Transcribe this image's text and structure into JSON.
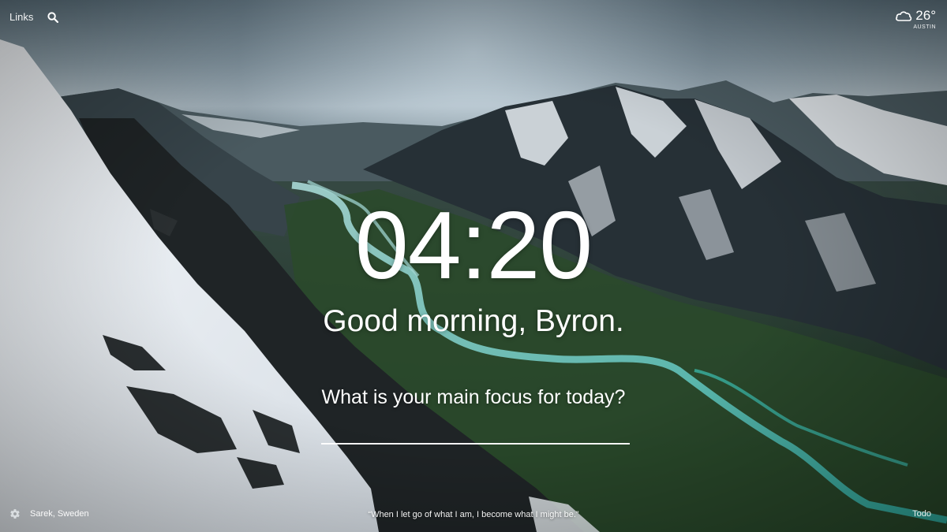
{
  "top_left": {
    "links_label": "Links",
    "search_icon": "search-icon"
  },
  "weather": {
    "icon": "cloud-icon",
    "temperature": "26°",
    "location": "AUSTIN"
  },
  "center": {
    "time": "04:20",
    "greeting": "Good morning, Byron.",
    "focus_question": "What is your main focus for today?",
    "focus_value": ""
  },
  "bottom": {
    "settings_icon": "gear-icon",
    "photo_location": "Sarek, Sweden",
    "quote": "“When I let go of what I am, I become what I might be.”",
    "todo_label": "Todo"
  }
}
